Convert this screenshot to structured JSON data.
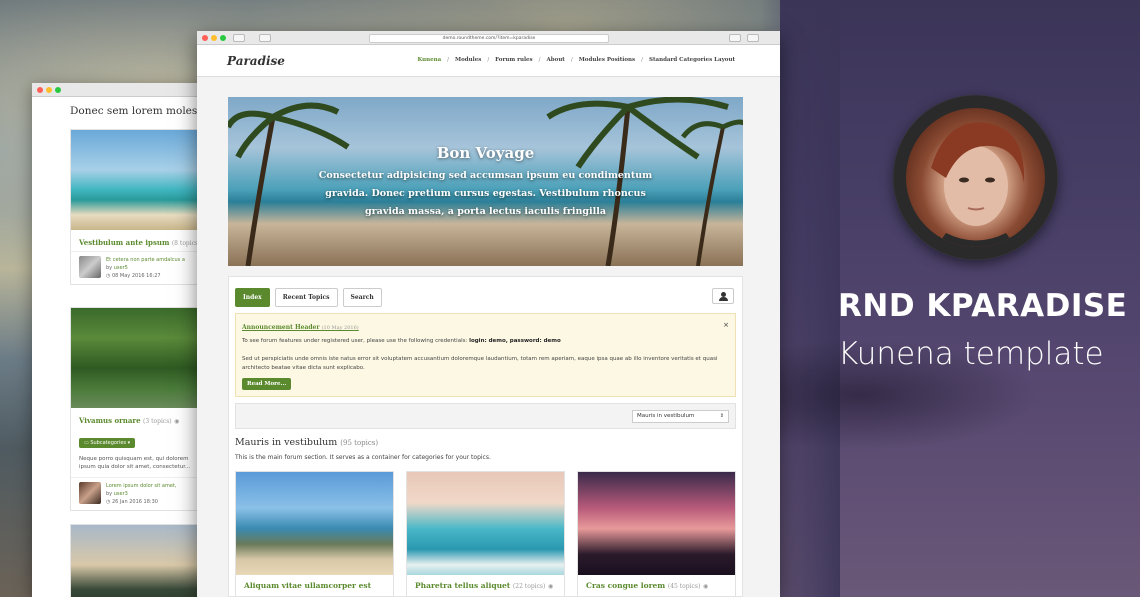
{
  "main": {
    "url": "demo.roundtheme.com/?item=kparadise",
    "logo": "Paradise",
    "menu": [
      "Kunena",
      "Modules",
      "Forum rules",
      "About",
      "Modules Positions",
      "Standard Categories Layout"
    ],
    "menu_sep": "/",
    "hero": {
      "title": "Bon Voyage",
      "text": "Consectetur adipisicing sed accumsan ipsum eu condimentum gravida. Donec pretium cursus egestas. Vestibulum rhoncus gravida massa, a porta lectus iaculis fringilla"
    },
    "tabs": [
      "Index",
      "Recent Topics",
      "Search"
    ],
    "announcement": {
      "header": "Announcement Header",
      "date": "(10 May 2016)",
      "close": "×",
      "line1_pre": "To see forum features under registered user, please use the following credentials: ",
      "line1_bold": "login: demo, password: demo",
      "line2": "Sed ut perspiciatis unde omnis iste natus error sit voluptatem accusantium doloremque laudantium, totam rem aperiam, eaque ipsa quae ab illo inventore veritatis et quasi architecto beatae vitae dicta sunt explicabo.",
      "read_more": "Read More..."
    },
    "select_value": "Mauris in vestibulum",
    "section": {
      "title": "Mauris in vestibulum",
      "count": "(95 topics)",
      "desc": "This is the main forum section. It serves as a container for categories for your topics."
    },
    "cards": [
      {
        "title": "Aliquam vitae ullamcorper est",
        "count": ""
      },
      {
        "title": "Pharetra tellus aliquet",
        "count": "(22 topics)"
      },
      {
        "title": "Cras congue lorem",
        "count": "(45 topics)"
      }
    ]
  },
  "back": {
    "heading": "Donec sem lorem molestie",
    "cards": [
      {
        "title": "Vestibulum ante ipsum",
        "count": "(8 topics)",
        "post": "Et cetera non parte amdalcus a",
        "by": "by",
        "user": "user5",
        "date": "08 May 2016 16:27"
      },
      {
        "title": "Vivamus ornare",
        "count": "(3 topics)",
        "subcat": "Subcategories",
        "excerpt": "Neque porro quisquam est, qui dolorem ipsum quia dolor sit amet, consectetur...",
        "post": "Lorem ipsum dolor sit amet,",
        "by": "by",
        "user": "user3",
        "date": "26 Jan 2016 18:30"
      }
    ]
  },
  "brand": {
    "title": "RND KPARADISE",
    "subtitle": "Kunena template"
  },
  "colors": {
    "accent": "#5b8a2e",
    "brand_bg": "#3b3558"
  }
}
